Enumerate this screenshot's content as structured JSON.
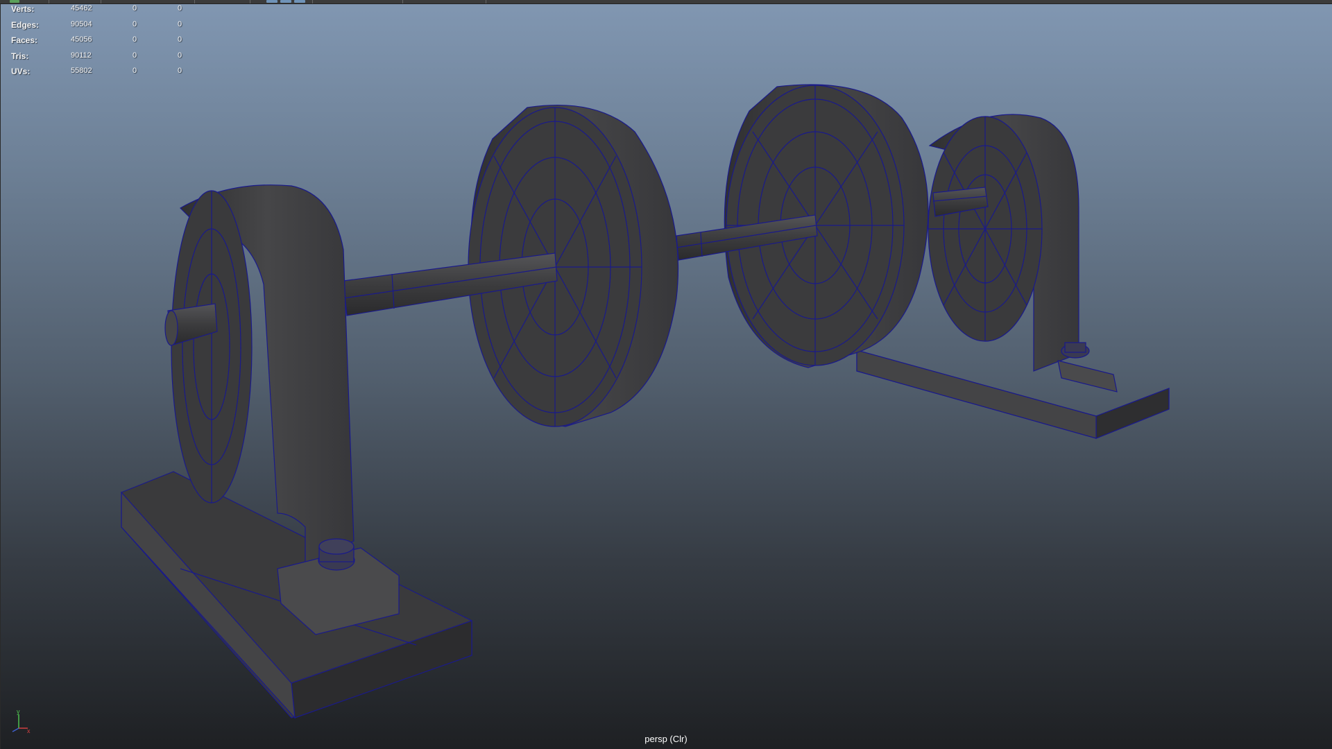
{
  "viewport": {
    "camera_label": "persp (Clr)"
  },
  "heads_up_display": {
    "rows": [
      {
        "label": "Verts:",
        "total": "45462",
        "selected": "0",
        "components": "0"
      },
      {
        "label": "Edges:",
        "total": "90504",
        "selected": "0",
        "components": "0"
      },
      {
        "label": "Faces:",
        "total": "45056",
        "selected": "0",
        "components": "0"
      },
      {
        "label": "Tris:",
        "total": "90112",
        "selected": "0",
        "components": "0"
      },
      {
        "label": "UVs:",
        "total": "55802",
        "selected": "0",
        "components": "0"
      }
    ]
  },
  "axis_gizmo": {
    "y": "y",
    "x": "x"
  },
  "colors": {
    "background_top": "#8197b2",
    "background_bottom": "#1e2023",
    "mesh_face": "#3d3d3f",
    "wireframe": "#1a1a8a"
  }
}
